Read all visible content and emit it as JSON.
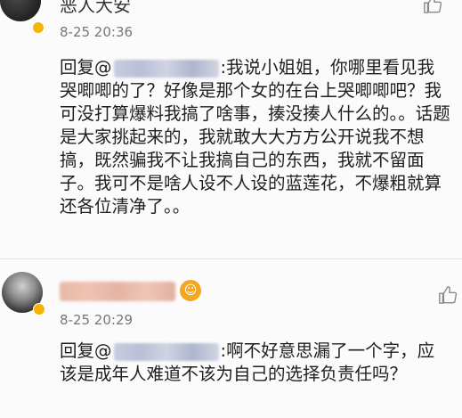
{
  "comments": [
    {
      "username": "恶人大安",
      "timestamp": "8-25 20:36",
      "reply_prefix": "回复@",
      "reply_text": ":我说小姐姐，你哪里看见我哭唧唧的了？好像是那个女的在台上哭唧唧吧？我可没打算爆料我搞了啥事，揍没揍人什么的。。话题是大家挑起来的，我就敢大大方方公开说我不想搞，既然骗我不让我搞自己的东西，我就不留面子。我可不是啥人设不人设的蓝莲花，不爆粗就算还各位清净了。。"
    },
    {
      "timestamp": "8-25 20:29",
      "reply_prefix": "回复@",
      "reply_text": ":啊不好意思漏了一个字，应该是成年人难道不该为自己的选择负责任吗？"
    }
  ],
  "icons": {
    "like": "thumbs-up-icon",
    "verified": "verified-badge-icon"
  }
}
